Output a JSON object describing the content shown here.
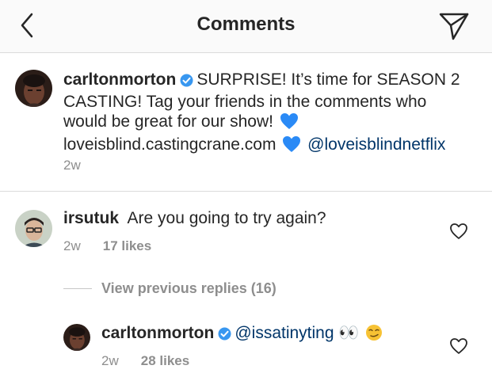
{
  "header": {
    "title": "Comments",
    "back_icon": "chevron-left-icon",
    "send_icon": "paper-plane-icon"
  },
  "caption": {
    "username": "carltonmorton",
    "verified": true,
    "text_line1": "SURPRISE! It’s time for SEASON 2",
    "text_line2": "CASTING! Tag your friends in the comments who",
    "text_line3": "would be great for our show!",
    "link": "loveisblind.castingcrane.com",
    "mention": "@loveisblindnetflix",
    "time": "2w",
    "emoji": "blue-heart"
  },
  "comments": [
    {
      "username": "irsutuk",
      "text": "Are you going to try again?",
      "time": "2w",
      "likes": "17 likes"
    }
  ],
  "view_replies": "View previous replies (16)",
  "reply": {
    "username": "carltonmorton",
    "verified": true,
    "mention": "@issatinyting",
    "emojis": "👀",
    "emoji2": "smirk-face",
    "time": "2w",
    "likes": "28 likes"
  },
  "colors": {
    "verified_blue": "#3897f0",
    "mention_blue": "#003569",
    "heart_blue": "#2a8af6",
    "meta_gray": "#8e8e8e"
  }
}
